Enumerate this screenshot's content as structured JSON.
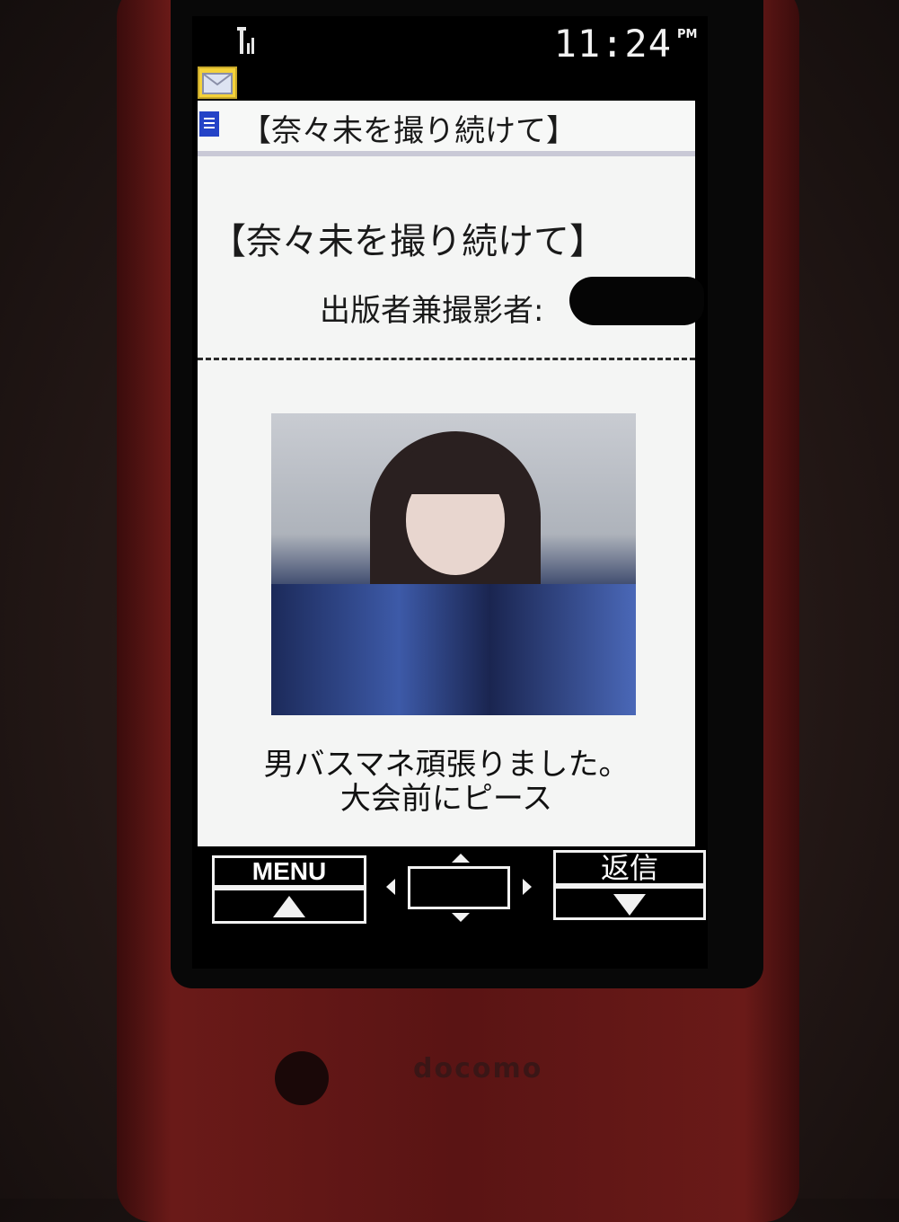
{
  "status_bar": {
    "time": "11:24",
    "ampm": "PM",
    "signal_icon": "signal-icon"
  },
  "mail": {
    "icon": "mail-icon",
    "doc_icon": "document-icon",
    "title": "【奈々未を撮り続けて】"
  },
  "body": {
    "heading": "【奈々未を撮り続けて】",
    "author_label": "出版者兼撮影者:",
    "caption_line1": "男バスマネ頑張りました。",
    "caption_line2": "大会前にピース"
  },
  "softkeys": {
    "menu_label": "MENU",
    "reply_label": "返信"
  },
  "device": {
    "brand": "docomo"
  }
}
